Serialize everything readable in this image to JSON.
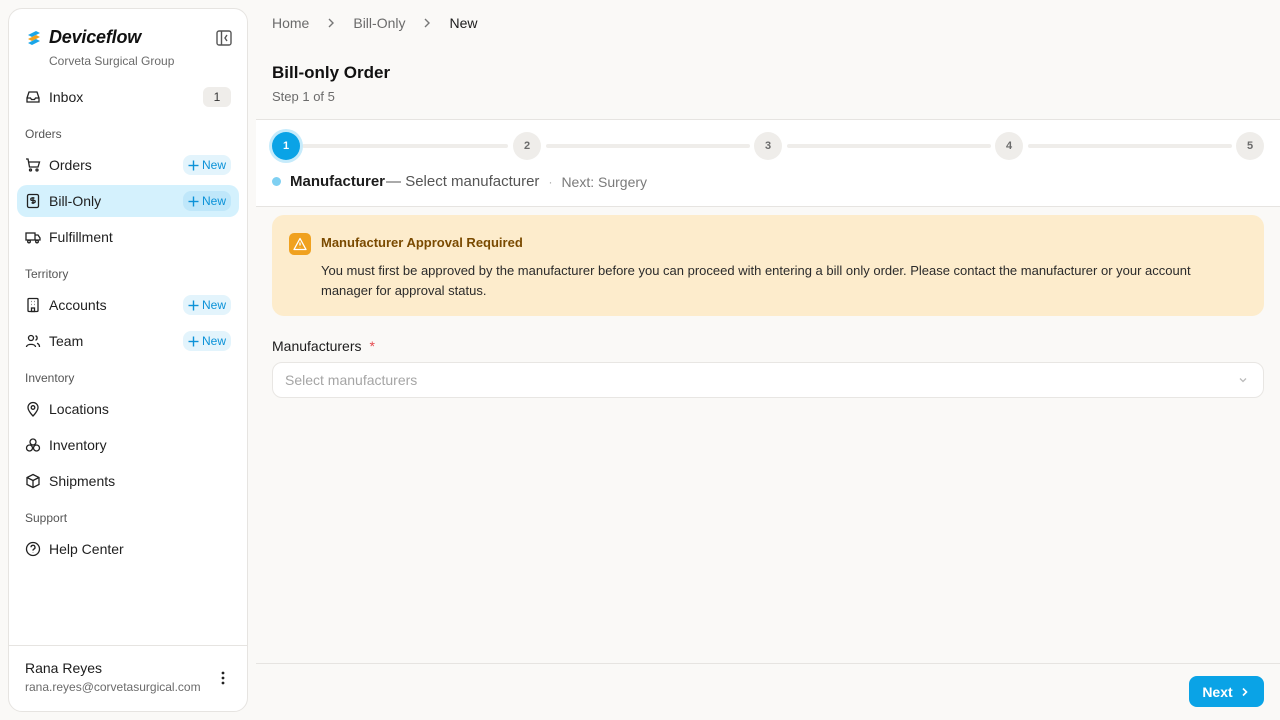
{
  "brand": {
    "name": "Deviceflow",
    "org": "Corveta Surgical Group"
  },
  "sidebar": {
    "inbox": {
      "label": "Inbox",
      "count": "1"
    },
    "sections": {
      "orders": "Orders",
      "territory": "Territory",
      "inventory": "Inventory",
      "support": "Support"
    },
    "items": {
      "orders": "Orders",
      "bill_only": "Bill-Only",
      "fulfillment": "Fulfillment",
      "accounts": "Accounts",
      "team": "Team",
      "locations": "Locations",
      "inventory": "Inventory",
      "shipments": "Shipments",
      "help_center": "Help Center"
    },
    "new_label": "New",
    "active_item": "Bill-Only"
  },
  "user": {
    "name": "Rana Reyes",
    "email": "rana.reyes@corvetasurgical.com"
  },
  "breadcrumb": [
    "Home",
    "Bill-Only",
    "New"
  ],
  "page": {
    "title": "Bill-only Order",
    "subtitle": "Step 1 of 5"
  },
  "stepper": {
    "steps": [
      "1",
      "2",
      "3",
      "4",
      "5"
    ],
    "current": 1,
    "caption_name": "Manufacturer",
    "caption_desc": "— Select manufacturer",
    "caption_sep": "·",
    "caption_next": "Next: Surgery"
  },
  "alert": {
    "title": "Manufacturer Approval Required",
    "body": "You must first be approved by the manufacturer before you can proceed with entering a bill only order. Please contact the manufacturer or your account manager for approval status."
  },
  "form": {
    "manufacturers_label": "Manufacturers",
    "required_mark": "*",
    "manufacturers_placeholder": "Select manufacturers"
  },
  "footer": {
    "next_label": "Next"
  },
  "colors": {
    "accent": "#0aa3e6",
    "active_bg": "#d4f1fd",
    "warning_bg": "#fdeccc",
    "warning_icon": "#f0a11f"
  }
}
